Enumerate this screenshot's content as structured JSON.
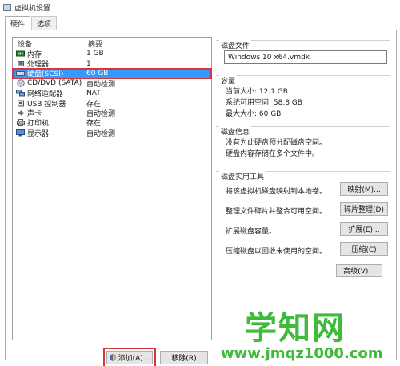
{
  "window": {
    "title": "虚拟机设置"
  },
  "tabs": [
    {
      "label": "硬件",
      "active": true
    },
    {
      "label": "选项",
      "active": false
    }
  ],
  "device_list": {
    "headers": {
      "device": "设备",
      "summary": "摘要"
    },
    "rows": [
      {
        "icon": "memory-icon",
        "device": "内存",
        "summary": "1 GB",
        "selected": false
      },
      {
        "icon": "cpu-icon",
        "device": "处理器",
        "summary": "1",
        "selected": false
      },
      {
        "icon": "hard-disk-icon",
        "device": "硬盘(SCSI)",
        "summary": "60 GB",
        "selected": true
      },
      {
        "icon": "cd-dvd-icon",
        "device": "CD/DVD (SATA)",
        "summary": "自动检测",
        "selected": false
      },
      {
        "icon": "network-adapter-icon",
        "device": "网络适配器",
        "summary": "NAT",
        "selected": false
      },
      {
        "icon": "usb-icon",
        "device": "USB 控制器",
        "summary": "存在",
        "selected": false
      },
      {
        "icon": "sound-card-icon",
        "device": "声卡",
        "summary": "自动检测",
        "selected": false
      },
      {
        "icon": "printer-icon",
        "device": "打印机",
        "summary": "存在",
        "selected": false
      },
      {
        "icon": "display-icon",
        "device": "显示器",
        "summary": "自动检测",
        "selected": false
      }
    ],
    "add_label": "添加(A)...",
    "remove_label": "移除(R)"
  },
  "disk_file": {
    "title": "磁盘文件",
    "value": "Windows 10 x64.vmdk"
  },
  "capacity": {
    "title": "容量",
    "current_size": "当前大小: 12.1 GB",
    "available": "系统可用空间: 58.8 GB",
    "max_size": "最大大小: 60 GB"
  },
  "disk_info": {
    "title": "磁盘信息",
    "line1": "没有为此硬盘预分配磁盘空间。",
    "line2": "硬盘内容存储在多个文件中。"
  },
  "utilities": {
    "title": "磁盘实用工具",
    "items": [
      {
        "desc": "将该虚拟机磁盘映射到本地卷。",
        "button": "映射(M)..."
      },
      {
        "desc": "整理文件碎片并整合可用空间。",
        "button": "碎片整理(D)"
      },
      {
        "desc": "扩展磁盘容量。",
        "button": "扩展(E)..."
      },
      {
        "desc": "压缩磁盘以回收未使用的空间。",
        "button": "压缩(C)"
      }
    ]
  },
  "advanced_label": "高级(V)...",
  "watermark": {
    "main": "学知网",
    "url": "www.jmqz1000.com"
  },
  "colors": {
    "selection": "#3399ff",
    "highlight_border": "#d9343a",
    "watermark": "#3fba3b"
  }
}
